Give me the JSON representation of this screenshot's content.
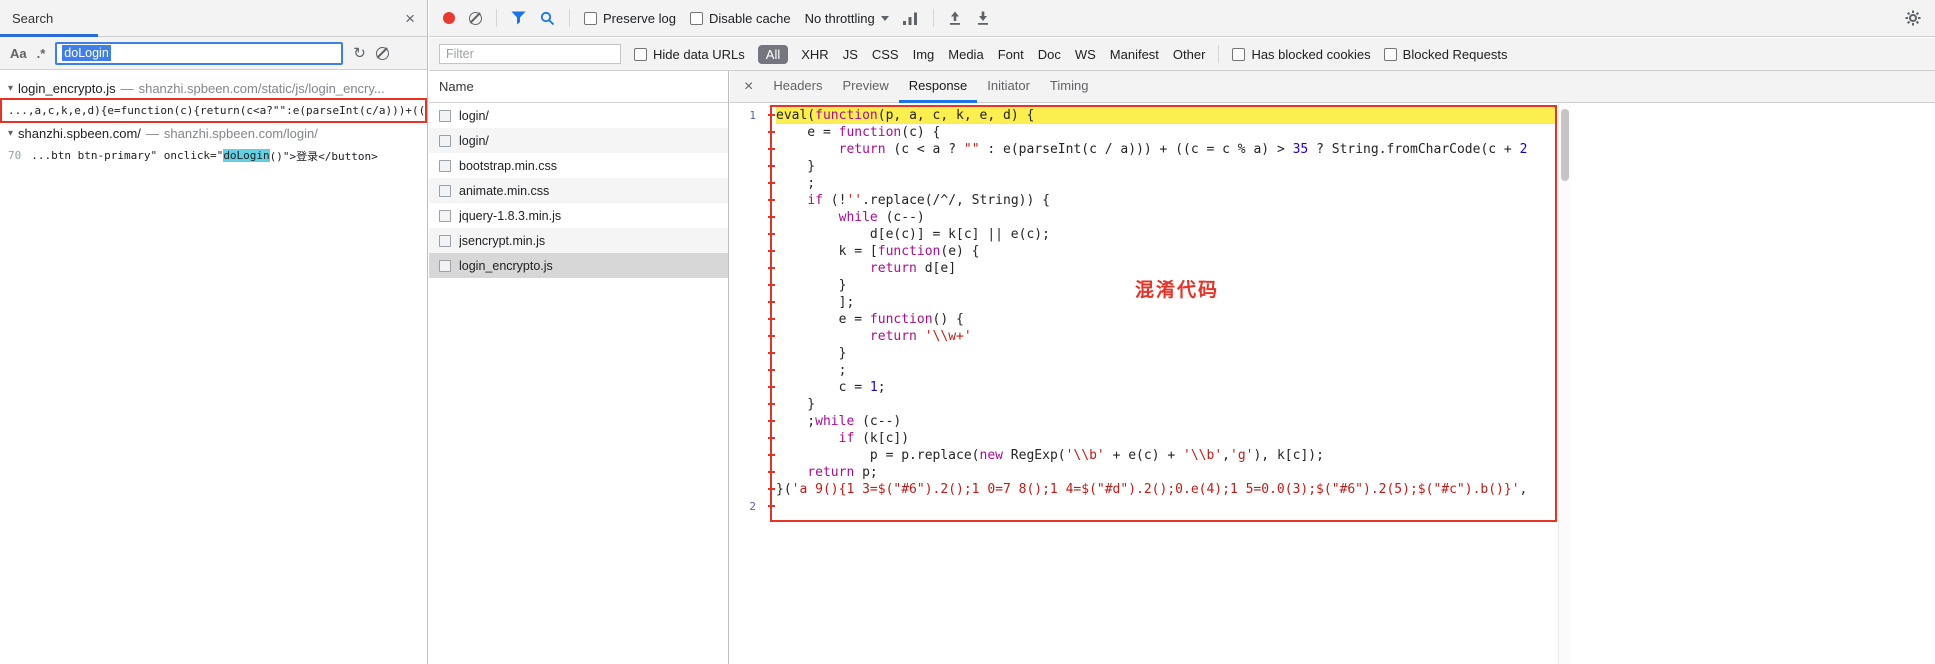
{
  "colors": {
    "accent_blue": "#1a73e8",
    "record_red": "#ea3a30",
    "annotation_red": "#e93226",
    "line_highlight_yellow": "#fbee4f",
    "match_highlight_cyan": "#63cfe0",
    "keyword_color": "#aa0d91",
    "number_color": "#1c00cf",
    "string_color": "#c41a16"
  },
  "icons": {
    "close": "×",
    "refresh": "↻",
    "collapse_arrow": "▾"
  },
  "search": {
    "title": "Search",
    "match_case_label": "Aa",
    "regex_label": ".*",
    "query": "doLogin",
    "groups": [
      {
        "file": "login_encrypto.js",
        "separator": "—",
        "url": "shanzhi.spbeen.com/static/js/login_encry...",
        "matches": [
          {
            "line_no": "",
            "prefix": "...,a,c,k,e,d){e=function(c){return(c<a?\"\":e(parseInt(c/a)))+((c..",
            "match": "",
            "suffix": "",
            "boxed": true
          }
        ]
      },
      {
        "file": "shanzhi.spbeen.com/",
        "separator": "—",
        "url": "shanzhi.spbeen.com/login/",
        "matches": [
          {
            "line_no": "70",
            "prefix": "...btn btn-primary\" onclick=\"",
            "match": "doLogin",
            "suffix": "()\">登录</button>",
            "boxed": false
          }
        ]
      }
    ]
  },
  "toolbar": {
    "preserve_log": "Preserve log",
    "disable_cache": "Disable cache",
    "throttling": "No throttling"
  },
  "filter_bar": {
    "placeholder": "Filter",
    "hide_data_urls": "Hide data URLs",
    "selected_type": "All",
    "types": [
      "XHR",
      "JS",
      "CSS",
      "Img",
      "Media",
      "Font",
      "Doc",
      "WS",
      "Manifest",
      "Other"
    ],
    "has_blocked_cookies": "Has blocked cookies",
    "blocked_requests": "Blocked Requests"
  },
  "network": {
    "name_header": "Name",
    "rows": [
      {
        "name": "login/",
        "selected": false
      },
      {
        "name": "login/",
        "selected": false
      },
      {
        "name": "bootstrap.min.css",
        "selected": false
      },
      {
        "name": "animate.min.css",
        "selected": false
      },
      {
        "name": "jquery-1.8.3.min.js",
        "selected": false
      },
      {
        "name": "jsencrypt.min.js",
        "selected": false
      },
      {
        "name": "login_encrypto.js",
        "selected": true
      }
    ]
  },
  "details": {
    "tabs": [
      "Headers",
      "Preview",
      "Response",
      "Initiator",
      "Timing"
    ],
    "active_tab": "Response",
    "annotation": "混淆代码",
    "code_lines": [
      {
        "gutter": "1",
        "highlight": true,
        "tokens": [
          [
            "d",
            "eval("
          ],
          [
            "k",
            "function"
          ],
          [
            "d",
            "(p, a, c, k, e, d) {"
          ]
        ]
      },
      {
        "tokens": [
          [
            "d",
            "    e = "
          ],
          [
            "k",
            "function"
          ],
          [
            "d",
            "(c) {"
          ]
        ]
      },
      {
        "tokens": [
          [
            "d",
            "        "
          ],
          [
            "k",
            "return"
          ],
          [
            "d",
            " (c < a ? "
          ],
          [
            "s",
            "\"\""
          ],
          [
            "d",
            " : e(parseInt(c / a))) + ((c = c % a) > "
          ],
          [
            "n",
            "35"
          ],
          [
            "d",
            " ? String.fromCharCode(c + "
          ],
          [
            "n",
            "2"
          ]
        ]
      },
      {
        "tokens": [
          [
            "d",
            "    }"
          ]
        ]
      },
      {
        "tokens": [
          [
            "d",
            "    ;"
          ]
        ]
      },
      {
        "tokens": [
          [
            "d",
            "    "
          ],
          [
            "k",
            "if"
          ],
          [
            "d",
            " (!"
          ],
          [
            "s",
            "''"
          ],
          [
            "d",
            ".replace(/^/, String)) {"
          ]
        ]
      },
      {
        "tokens": [
          [
            "d",
            "        "
          ],
          [
            "k",
            "while"
          ],
          [
            "d",
            " (c--)"
          ]
        ]
      },
      {
        "tokens": [
          [
            "d",
            "            d[e(c)] = k[c] || e(c);"
          ]
        ]
      },
      {
        "tokens": [
          [
            "d",
            "        k = ["
          ],
          [
            "k",
            "function"
          ],
          [
            "d",
            "(e) {"
          ]
        ]
      },
      {
        "tokens": [
          [
            "d",
            "            "
          ],
          [
            "k",
            "return"
          ],
          [
            "d",
            " d[e]"
          ]
        ]
      },
      {
        "tokens": [
          [
            "d",
            "        }"
          ]
        ]
      },
      {
        "tokens": [
          [
            "d",
            "        ];"
          ]
        ]
      },
      {
        "tokens": [
          [
            "d",
            "        e = "
          ],
          [
            "k",
            "function"
          ],
          [
            "d",
            "() {"
          ]
        ]
      },
      {
        "tokens": [
          [
            "d",
            "            "
          ],
          [
            "k",
            "return"
          ],
          [
            "d",
            " "
          ],
          [
            "s",
            "'\\\\w+'"
          ]
        ]
      },
      {
        "tokens": [
          [
            "d",
            "        }"
          ]
        ]
      },
      {
        "tokens": [
          [
            "d",
            "        ;"
          ]
        ]
      },
      {
        "tokens": [
          [
            "d",
            "        c = "
          ],
          [
            "n",
            "1"
          ],
          [
            "d",
            ";"
          ]
        ]
      },
      {
        "tokens": [
          [
            "d",
            "    }"
          ]
        ]
      },
      {
        "tokens": [
          [
            "d",
            "    ;"
          ],
          [
            "k",
            "while"
          ],
          [
            "d",
            " (c--)"
          ]
        ]
      },
      {
        "tokens": [
          [
            "d",
            "        "
          ],
          [
            "k",
            "if"
          ],
          [
            "d",
            " (k[c])"
          ]
        ]
      },
      {
        "tokens": [
          [
            "d",
            "            p = p.replace("
          ],
          [
            "k",
            "new"
          ],
          [
            "d",
            " RegExp("
          ],
          [
            "s",
            "'\\\\b'"
          ],
          [
            "d",
            " + e(c) + "
          ],
          [
            "s",
            "'\\\\b'"
          ],
          [
            "d",
            ","
          ],
          [
            "s",
            "'g'"
          ],
          [
            "d",
            "), k[c]);"
          ]
        ]
      },
      {
        "tokens": [
          [
            "d",
            "    "
          ],
          [
            "k",
            "return"
          ],
          [
            "d",
            " p;"
          ]
        ]
      },
      {
        "tokens": [
          [
            "d",
            "}("
          ],
          [
            "s",
            "'a 9(){1 3=$(\"#6\").2();1 0=7 8();1 4=$(\"#d\").2();0.e(4);1 5=0.0(3);$(\"#6\").2(5);$(\"#c\").b()}'"
          ],
          [
            "d",
            ","
          ]
        ]
      },
      {
        "gutter": "2",
        "tokens": []
      }
    ]
  }
}
